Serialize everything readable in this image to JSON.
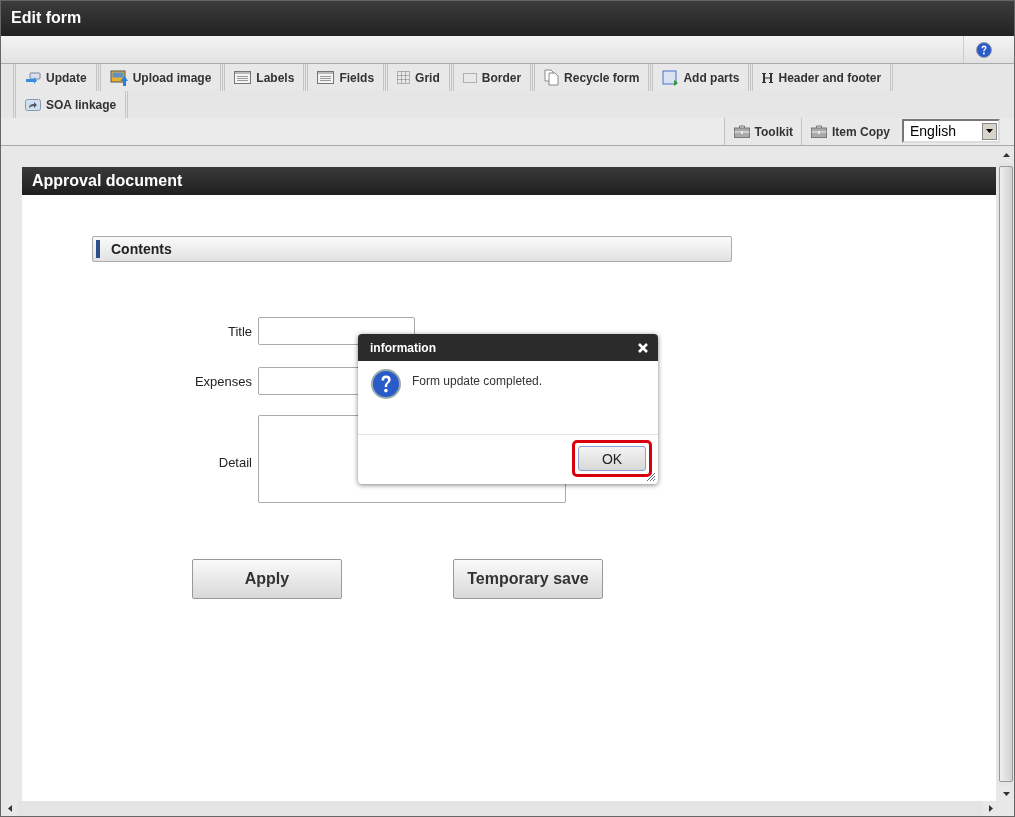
{
  "window": {
    "title": "Edit form"
  },
  "toolbar": {
    "tabs": [
      {
        "label": "Update",
        "kind": "update"
      },
      {
        "label": "Upload image",
        "kind": "image"
      },
      {
        "label": "Labels",
        "kind": "list"
      },
      {
        "label": "Fields",
        "kind": "list"
      },
      {
        "label": "Grid",
        "kind": "grid"
      },
      {
        "label": "Border",
        "kind": "border"
      },
      {
        "label": "Recycle form",
        "kind": "pages"
      },
      {
        "label": "Add parts",
        "kind": "parts"
      },
      {
        "label": "Header and footer",
        "kind": "heading"
      },
      {
        "label": "SOA linkage",
        "kind": "link"
      }
    ],
    "tools": [
      {
        "label": "Toolkit",
        "kind": "toolbox"
      },
      {
        "label": "Item Copy",
        "kind": "toolbox"
      }
    ],
    "language": {
      "value": "English"
    }
  },
  "panel": {
    "title": "Approval document",
    "section": "Contents",
    "fields": [
      {
        "label": "Title",
        "kind": "text"
      },
      {
        "label": "Expenses",
        "kind": "text"
      },
      {
        "label": "Detail",
        "kind": "textarea"
      }
    ],
    "buttons": [
      "Apply",
      "Temporary save"
    ]
  },
  "dialog": {
    "title": "information",
    "message": "Form update completed.",
    "button": "OK",
    "highlighted": true
  }
}
